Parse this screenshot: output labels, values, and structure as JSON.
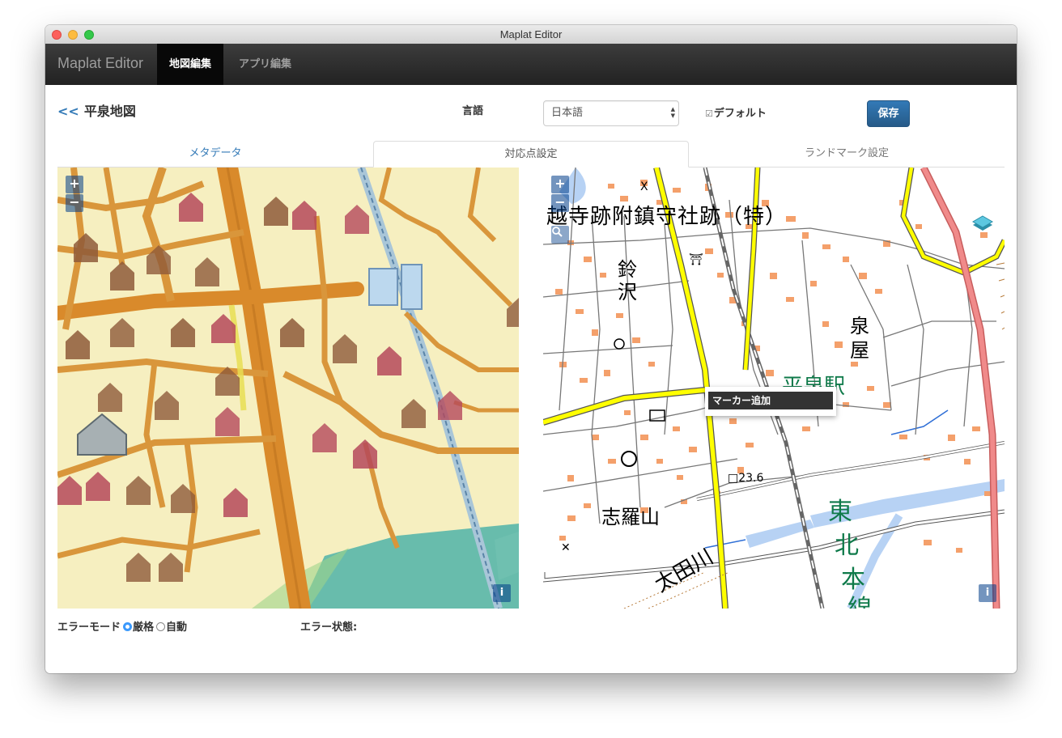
{
  "window": {
    "title": "Maplat Editor"
  },
  "navbar": {
    "brand": "Maplat Editor",
    "items": [
      {
        "label": "地図編集",
        "active": true
      },
      {
        "label": "アプリ編集",
        "active": false
      }
    ]
  },
  "header": {
    "back_arrow": "<<",
    "map_title": "平泉地図",
    "language_label": "言語",
    "language_value": "日本語",
    "default_label": "デフォルト",
    "default_checked": true,
    "save_label": "保存"
  },
  "tabs": [
    {
      "label": "メタデータ",
      "active": false
    },
    {
      "label": "対応点設定",
      "active": true
    },
    {
      "label": "ランドマーク設定",
      "active": false
    }
  ],
  "left_map": {
    "zoom_in": "+",
    "zoom_out": "−",
    "info": "i"
  },
  "right_map": {
    "zoom_in": "+",
    "zoom_out": "−",
    "search_icon": "search-icon",
    "layer_icon": "layers-icon",
    "info": "i",
    "labels": {
      "temple": "越寺跡附鎮守社跡（特）",
      "suzusawa_1": "鈴",
      "suzusawa_2": "沢",
      "izumiya_1": "泉",
      "izumiya_2": "屋",
      "station": "平泉駅",
      "elevation": "□23.6",
      "shiroyama": "志羅山",
      "tohoku_1": "東",
      "tohoku_2": "北",
      "tohoku_3": "本",
      "tohoku_4": "線",
      "river": "太田川"
    },
    "context_menu": {
      "item": "マーカー追加"
    }
  },
  "status": {
    "error_mode_label": "エラーモード",
    "mode_strict": "厳格",
    "mode_auto": "自動",
    "selected_mode": "厳格",
    "error_state_label": "エラー状態:"
  },
  "colors": {
    "accent": "#337ab7",
    "navbar": "#222222",
    "old_map_bg": "#f6efc0",
    "road_orange": "#d98a2b",
    "house_red": "#b5495b",
    "modern_road_yellow": "#ffff00",
    "building_orange": "#f4a06b"
  }
}
